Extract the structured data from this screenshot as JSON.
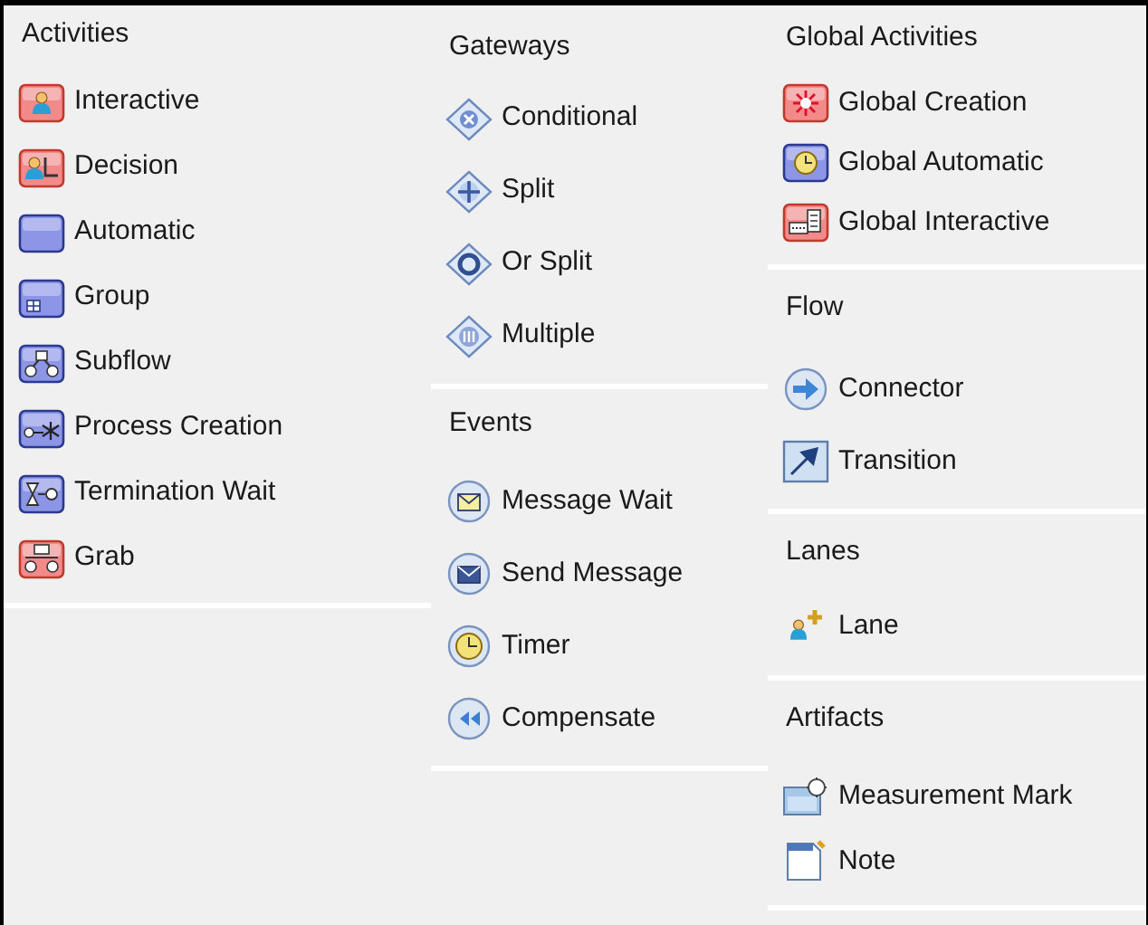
{
  "columns": [
    {
      "sections": [
        {
          "title": "Activities",
          "items": [
            {
              "label": "Interactive",
              "kind": "interactive"
            },
            {
              "label": "Decision",
              "kind": "decision"
            },
            {
              "label": "Automatic",
              "kind": "automatic"
            },
            {
              "label": "Group",
              "kind": "group"
            },
            {
              "label": "Subflow",
              "kind": "subflow"
            },
            {
              "label": "Process Creation",
              "kind": "creation"
            },
            {
              "label": "Termination Wait",
              "kind": "wait"
            },
            {
              "label": "Grab",
              "kind": "grab"
            }
          ]
        }
      ]
    },
    {
      "sections": [
        {
          "title": "Gateways",
          "items": [
            {
              "label": "Conditional",
              "kind": "conditional"
            },
            {
              "label": "Split",
              "kind": "split"
            },
            {
              "label": "Or Split",
              "kind": "orsplit"
            },
            {
              "label": "Multiple",
              "kind": "multiple"
            }
          ]
        },
        {
          "title": "Events",
          "items": [
            {
              "label": "Message Wait",
              "kind": "messagewait"
            },
            {
              "label": "Send Message",
              "kind": "sendmessage"
            },
            {
              "label": "Timer",
              "kind": "timer"
            },
            {
              "label": "Compensate",
              "kind": "compensate"
            }
          ]
        }
      ]
    },
    {
      "sections": [
        {
          "title": "Global Activities",
          "items": [
            {
              "label": "Global Creation",
              "kind": "globalcreation"
            },
            {
              "label": "Global Automatic",
              "kind": "globalautomatic"
            },
            {
              "label": "Global Interactive",
              "kind": "globalinteractive"
            }
          ]
        },
        {
          "title": "Flow",
          "items": [
            {
              "label": "Connector",
              "kind": "connector"
            },
            {
              "label": "Transition",
              "kind": "transition"
            }
          ]
        },
        {
          "title": "Lanes",
          "items": [
            {
              "label": "Lane",
              "kind": "lane"
            }
          ]
        },
        {
          "title": "Artifacts",
          "items": [
            {
              "label": "Measurement Mark",
              "kind": "measurement"
            },
            {
              "label": "Note",
              "kind": "note"
            }
          ]
        }
      ]
    }
  ]
}
